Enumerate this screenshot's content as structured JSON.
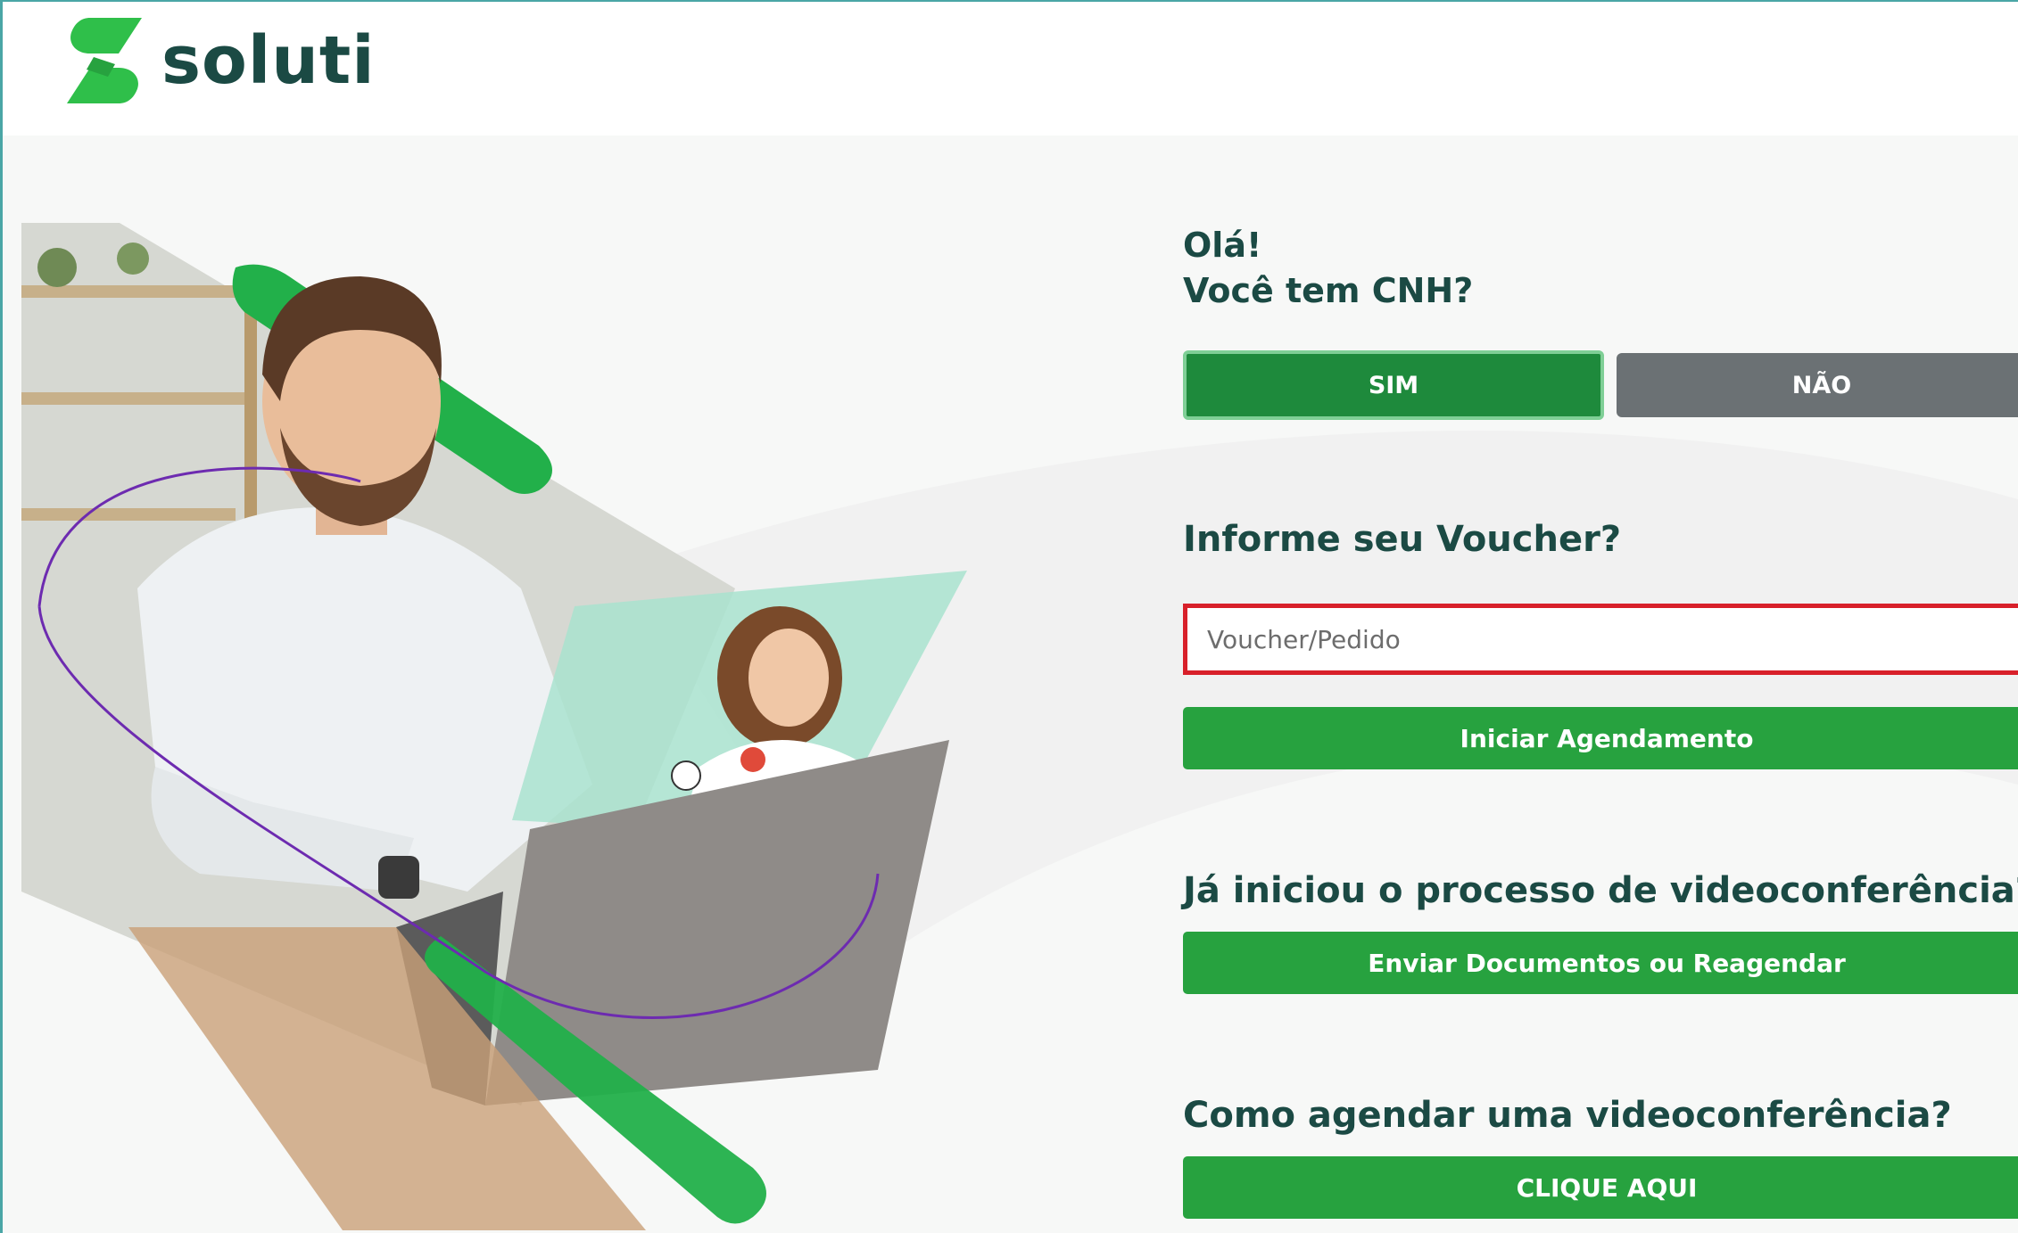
{
  "brand": {
    "name": "soluti"
  },
  "icons": {
    "logo": "soluti-s-logo-icon"
  },
  "colors": {
    "brand_dark": "#1b4a44",
    "accent_green": "#27a23f",
    "sim_green": "#1e8a3c",
    "nao_gray": "#6b7174",
    "input_error_border": "#d8202a"
  },
  "greeting": {
    "line1": "Olá!",
    "line2": "Você tem CNH?"
  },
  "cnh_options": {
    "sim": "SIM",
    "nao": "NÃO"
  },
  "voucher": {
    "title": "Informe seu Voucher?",
    "placeholder": "Voucher/Pedido",
    "value": "",
    "submit": "Iniciar Agendamento"
  },
  "video": {
    "title": "Já iniciou o processo de videoconferência?",
    "button": "Enviar Documentos ou Reagendar"
  },
  "howto": {
    "title": "Como agendar uma videoconferência?",
    "button": "CLIQUE AQUI"
  }
}
